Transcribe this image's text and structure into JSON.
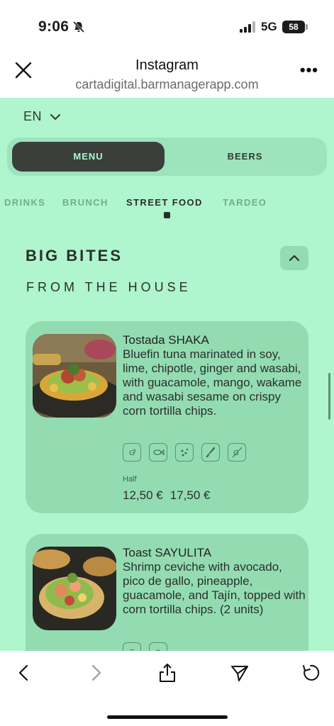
{
  "status_bar": {
    "time": "9:06",
    "network": "5G",
    "battery": "58"
  },
  "browser": {
    "title": "Instagram",
    "url": "cartadigital.barmanagerapp.com"
  },
  "language": {
    "label": "EN"
  },
  "segments": {
    "menu_label": "MENU",
    "beers_label": "BEERS"
  },
  "categories": [
    "DRINKS",
    "BRUNCH",
    "STREET FOOD",
    "TARDEO"
  ],
  "active_category": "STREET FOOD",
  "section": {
    "title": "BIG BITES",
    "subtitle": "FROM THE HOUSE"
  },
  "items": [
    {
      "name": "Tostada SHAKA",
      "description": "Bluefin tuna marinated in soy, lime, chipotle, ginger and wasabi, with guacamole, mango, wakame and wasabi sesame on crispy corn tortilla chips.",
      "allergen_icons": [
        "gluten-icon",
        "fish-icon",
        "soy-icon",
        "celery-icon",
        "gluten-free-icon"
      ],
      "price_label": "Half",
      "prices": [
        "12,50 €",
        "17,50 €"
      ]
    },
    {
      "name": "Toast SAYULITA",
      "description": "Shrimp ceviche with avocado, pico de gallo, pineapple, guacamole, and Tajín, topped with corn tortilla chips. (2 units)",
      "allergen_icons": [
        "gluten-icon",
        "crustacean-icon"
      ]
    }
  ],
  "colors": {
    "page_bg": "#aff5cd",
    "card_bg": "#93dcb2",
    "dark": "#3a3f3c",
    "accent_text": "#aff5cd"
  }
}
